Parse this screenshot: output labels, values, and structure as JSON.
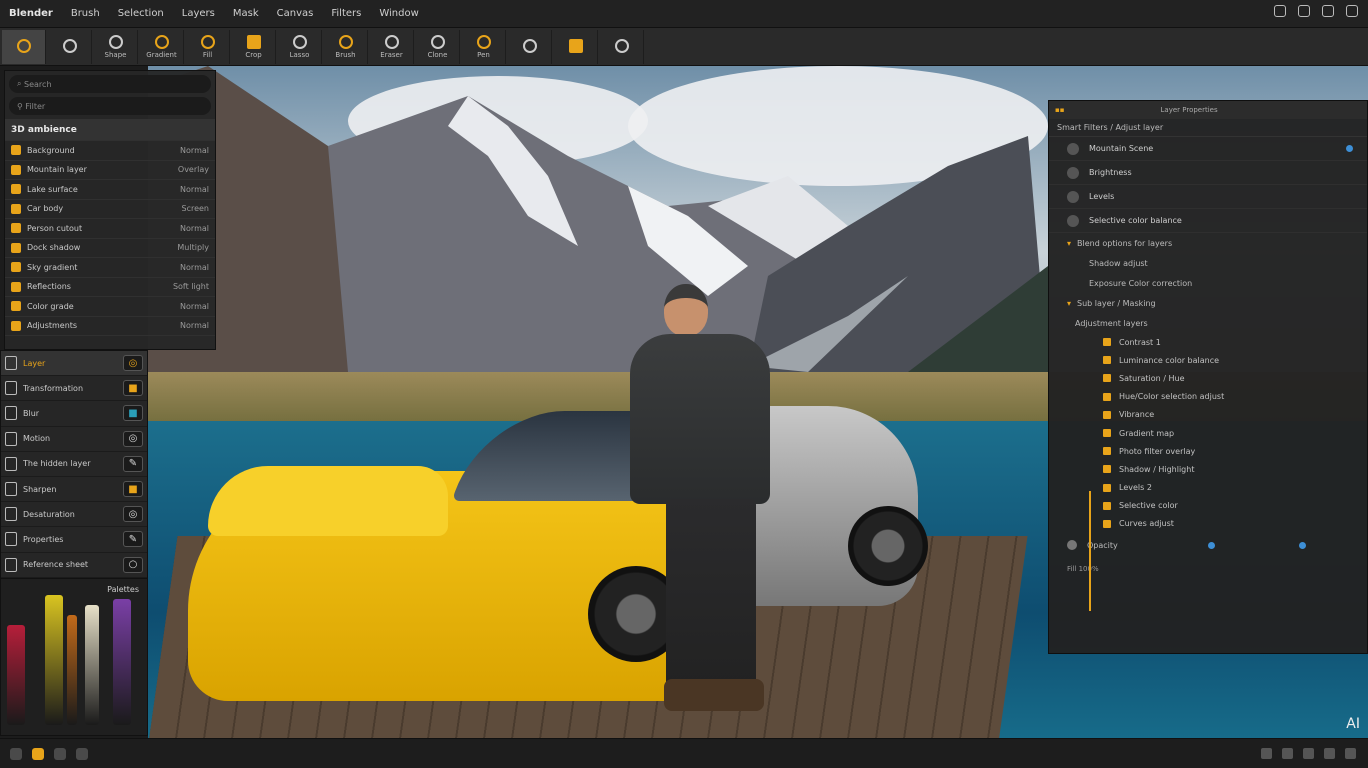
{
  "menubar": {
    "app_name": "Blender",
    "items": [
      "Brush",
      "Selection",
      "Layers",
      "Mask",
      "Canvas",
      "Filters",
      "Window"
    ]
  },
  "toolbar": {
    "tools": [
      {
        "label": "",
        "icon": "select-icon",
        "active": true
      },
      {
        "label": "",
        "icon": "text-icon"
      },
      {
        "label": "Shape",
        "icon": "shape-icon"
      },
      {
        "label": "Gradient",
        "icon": "gradient-icon"
      },
      {
        "label": "Fill",
        "icon": "fill-icon"
      },
      {
        "label": "Crop",
        "icon": "crop-icon"
      },
      {
        "label": "Lasso",
        "icon": "lasso-icon"
      },
      {
        "label": "Brush",
        "icon": "brush-icon"
      },
      {
        "label": "Eraser",
        "icon": "eraser-icon"
      },
      {
        "label": "Clone",
        "icon": "clone-icon"
      },
      {
        "label": "Pen",
        "icon": "pen-icon"
      },
      {
        "label": "",
        "icon": "eyedropper-icon"
      },
      {
        "label": "",
        "icon": "chevron-down-icon"
      },
      {
        "label": "",
        "icon": "settings-icon"
      }
    ]
  },
  "layers_panel": {
    "search_placeholder": "Search",
    "filter_label": "Filter",
    "header": "3D ambience",
    "items": [
      {
        "name": "Background",
        "sub": "Normal"
      },
      {
        "name": "Mountain layer",
        "sub": "Overlay"
      },
      {
        "name": "Lake surface",
        "sub": "Normal"
      },
      {
        "name": "Car body",
        "sub": "Screen"
      },
      {
        "name": "Person cutout",
        "sub": "Normal"
      },
      {
        "name": "Dock shadow",
        "sub": "Multiply"
      },
      {
        "name": "Sky gradient",
        "sub": "Normal"
      },
      {
        "name": "Reflections",
        "sub": "Soft light"
      },
      {
        "name": "Color grade",
        "sub": "Normal"
      },
      {
        "name": "Adjustments",
        "sub": "Normal"
      }
    ]
  },
  "tools_panel": {
    "rows": [
      {
        "label": "Layer",
        "icon": "layer-icon",
        "selected": true
      },
      {
        "label": "Transformation",
        "icon": "transform-icon"
      },
      {
        "label": "Blur",
        "icon": "blur-icon"
      },
      {
        "label": "Motion",
        "icon": "motion-icon"
      },
      {
        "label": "The hidden layer",
        "icon": "hidden-icon"
      },
      {
        "label": "Sharpen",
        "icon": "sharpen-icon"
      },
      {
        "label": "Desaturation",
        "icon": "desaturate-icon"
      },
      {
        "label": "Properties",
        "icon": "properties-icon"
      },
      {
        "label": "Reference sheet",
        "icon": "reference-icon"
      }
    ]
  },
  "swatches": {
    "title": "Palettes",
    "colors": [
      "#b61e3a",
      "#d9c420",
      "#7a3fa6",
      "#c26a1a",
      "#e7e0c8",
      "#5a2b7a"
    ]
  },
  "properties_panel": {
    "title": "Layer Properties",
    "subheader": "Smart Filters / Adjust layer",
    "rows": [
      "Mountain Scene",
      "Brightness",
      "Levels",
      "Selective color balance"
    ],
    "section1": "Blend options for layers",
    "section1_rows": [
      "Shadow adjust",
      "Exposure Color correction"
    ],
    "section2": "Sub layer / Masking",
    "list_header": "Adjustment layers",
    "list": [
      "Contrast 1",
      "Luminance color balance",
      "Saturation / Hue",
      "Hue/Color selection adjust",
      "Vibrance",
      "Gradient map",
      "Photo filter overlay",
      "Shadow / Highlight",
      "Levels 2",
      "Selective color",
      "Curves adjust"
    ],
    "footer_label": "Opacity",
    "footer_sub": "Fill 100%"
  },
  "canvas": {
    "watermark": "AI"
  }
}
